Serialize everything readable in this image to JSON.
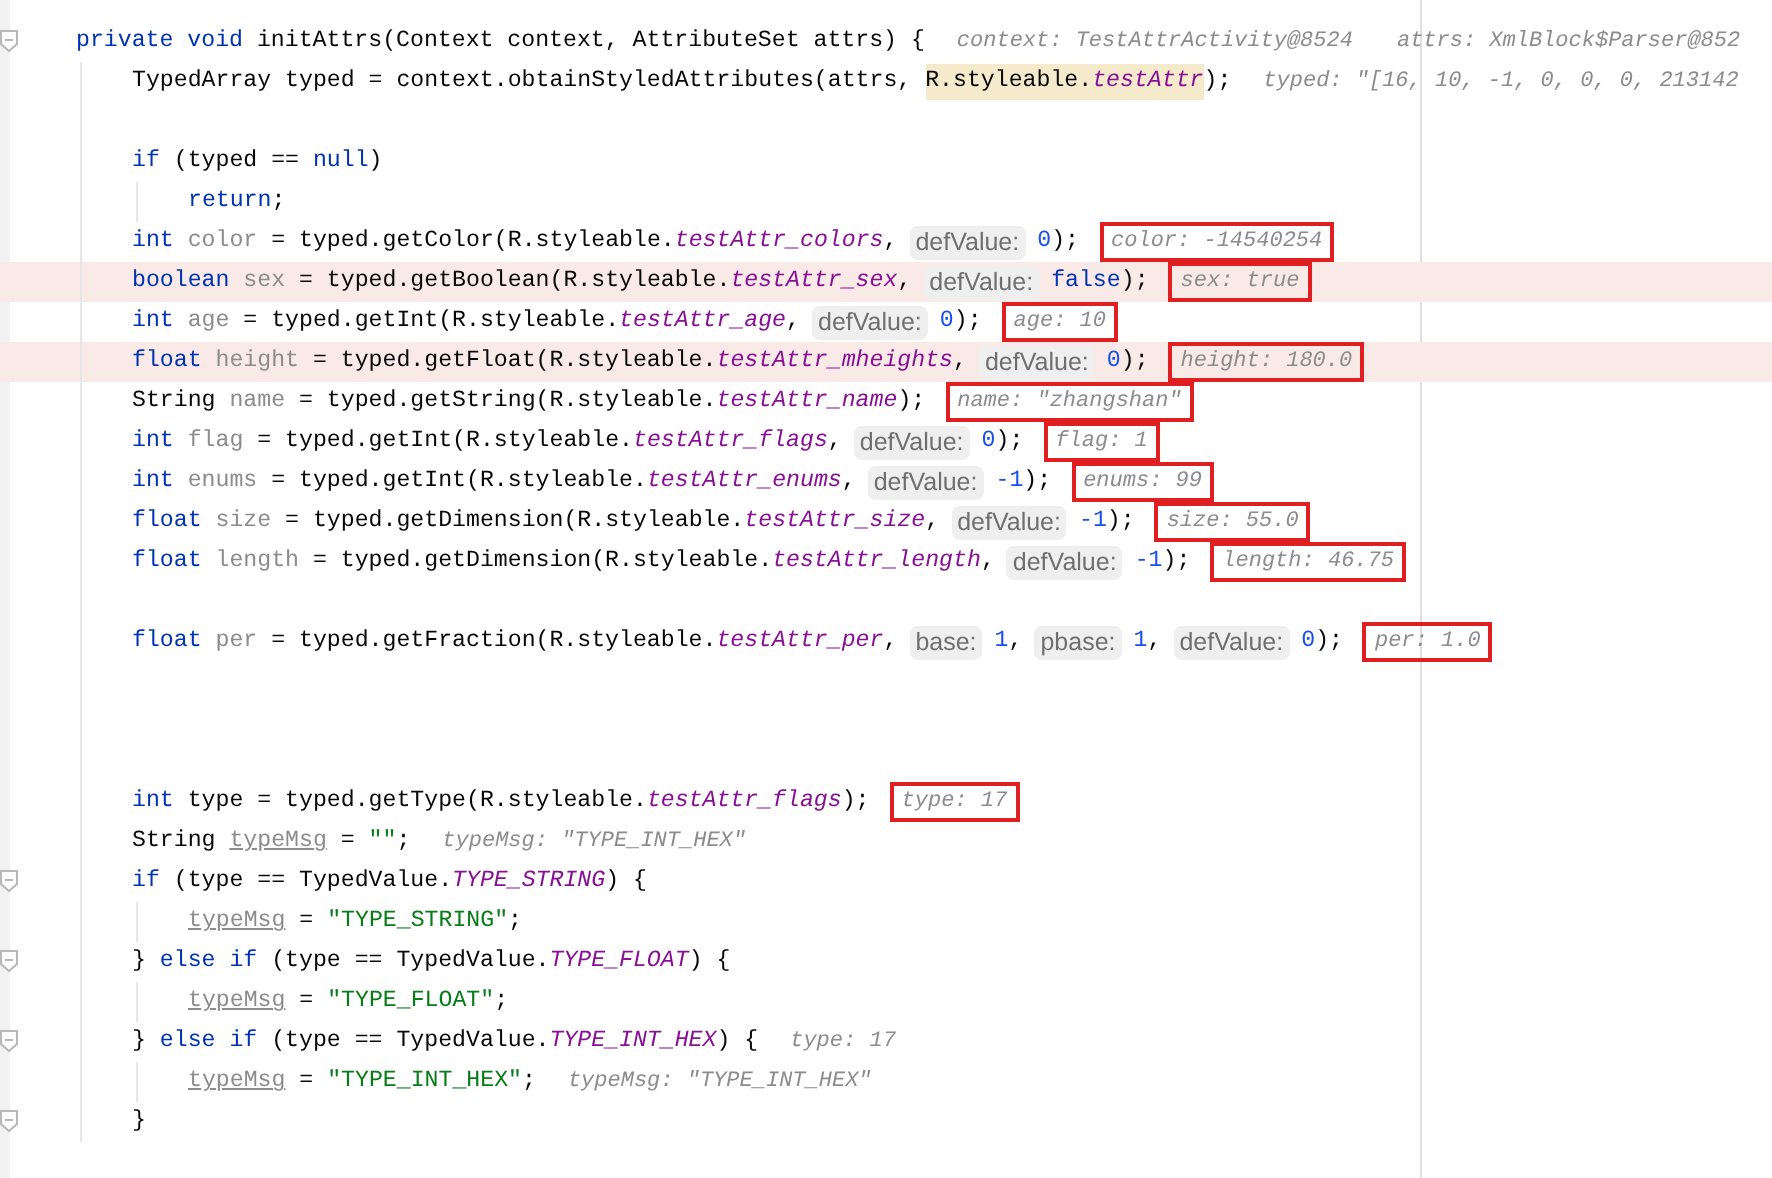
{
  "editor": {
    "lines": [
      {
        "kind": "code",
        "fold_marker": true,
        "tokens": [
          {
            "kind": "kw",
            "text": "private void "
          },
          {
            "kind": "plain",
            "text": "initAttrs(Context context, AttributeSet attrs) {"
          },
          {
            "kind": "inline",
            "text": "context: TestAttrActivity@8524"
          },
          {
            "kind": "inline",
            "text": "attrs: XmlBlock$Parser@852"
          }
        ],
        "children": [
          {
            "kind": "code",
            "tokens": [
              {
                "kind": "plain",
                "text": "TypedArray typed = context.obtainStyledAttributes(attrs, "
              },
              {
                "kind": "plain",
                "text": "R.styleable.",
                "highlighted": true
              },
              {
                "kind": "field",
                "text": "testAttr",
                "highlighted": true
              },
              {
                "kind": "plain",
                "text": ");"
              },
              {
                "kind": "inline",
                "text": "typed: \"[16, 10, -1, 0, 0, 0, 213142"
              }
            ]
          },
          {
            "kind": "blank"
          },
          {
            "kind": "code",
            "tokens": [
              {
                "kind": "kw",
                "text": "if"
              },
              {
                "kind": "plain",
                "text": " (typed == "
              },
              {
                "kind": "kw",
                "text": "null"
              },
              {
                "kind": "plain",
                "text": ")"
              }
            ],
            "children": [
              {
                "kind": "code",
                "tokens": [
                  {
                    "kind": "kw",
                    "text": "return"
                  },
                  {
                    "kind": "plain",
                    "text": ";"
                  }
                ]
              }
            ]
          },
          {
            "kind": "code",
            "tokens": [
              {
                "kind": "kw",
                "text": "int "
              },
              {
                "kind": "unused",
                "text": "color"
              },
              {
                "kind": "plain",
                "text": " = typed.getColor(R.styleable."
              },
              {
                "kind": "field",
                "text": "testAttr_colors"
              },
              {
                "kind": "plain",
                "text": ","
              },
              {
                "kind": "hint",
                "text": "defValue:"
              },
              {
                "kind": "num",
                "text": "0"
              },
              {
                "kind": "plain",
                "text": ");"
              },
              {
                "kind": "inline",
                "text": "color: -14540254",
                "boxed": true
              }
            ]
          },
          {
            "kind": "code",
            "highlighted": true,
            "tokens": [
              {
                "kind": "kw",
                "text": "boolean "
              },
              {
                "kind": "unused",
                "text": "sex"
              },
              {
                "kind": "plain",
                "text": " = typed.getBoolean(R.styleable."
              },
              {
                "kind": "field",
                "text": "testAttr_sex"
              },
              {
                "kind": "plain",
                "text": ","
              },
              {
                "kind": "hint",
                "text": "defValue:"
              },
              {
                "kind": "kw",
                "text": "false"
              },
              {
                "kind": "plain",
                "text": ");"
              },
              {
                "kind": "inline",
                "text": "sex: true",
                "boxed": true
              }
            ]
          },
          {
            "kind": "code",
            "tokens": [
              {
                "kind": "kw",
                "text": "int "
              },
              {
                "kind": "unused",
                "text": "age"
              },
              {
                "kind": "plain",
                "text": " = typed.getInt(R.styleable."
              },
              {
                "kind": "field",
                "text": "testAttr_age"
              },
              {
                "kind": "plain",
                "text": ","
              },
              {
                "kind": "hint",
                "text": "defValue:"
              },
              {
                "kind": "num",
                "text": "0"
              },
              {
                "kind": "plain",
                "text": ");"
              },
              {
                "kind": "inline",
                "text": "age: 10",
                "boxed": true
              }
            ]
          },
          {
            "kind": "code",
            "highlighted": true,
            "tokens": [
              {
                "kind": "kw",
                "text": "float "
              },
              {
                "kind": "unused",
                "text": "height"
              },
              {
                "kind": "plain",
                "text": " = typed.getFloat(R.styleable."
              },
              {
                "kind": "field",
                "text": "testAttr_mheights"
              },
              {
                "kind": "plain",
                "text": ","
              },
              {
                "kind": "hint",
                "text": "defValue:"
              },
              {
                "kind": "num",
                "text": "0"
              },
              {
                "kind": "plain",
                "text": ");"
              },
              {
                "kind": "inline",
                "text": "height: 180.0",
                "boxed": true
              }
            ]
          },
          {
            "kind": "code",
            "tokens": [
              {
                "kind": "plain",
                "text": "String "
              },
              {
                "kind": "unused",
                "text": "name"
              },
              {
                "kind": "plain",
                "text": " = typed.getString(R.styleable."
              },
              {
                "kind": "field",
                "text": "testAttr_name"
              },
              {
                "kind": "plain",
                "text": ");"
              },
              {
                "kind": "inline",
                "text": "name: \"zhangshan\"",
                "boxed": true
              }
            ]
          },
          {
            "kind": "code",
            "tokens": [
              {
                "kind": "kw",
                "text": "int "
              },
              {
                "kind": "unused",
                "text": "flag"
              },
              {
                "kind": "plain",
                "text": " = typed.getInt(R.styleable."
              },
              {
                "kind": "field",
                "text": "testAttr_flags"
              },
              {
                "kind": "plain",
                "text": ","
              },
              {
                "kind": "hint",
                "text": "defValue:"
              },
              {
                "kind": "num",
                "text": "0"
              },
              {
                "kind": "plain",
                "text": ");"
              },
              {
                "kind": "inline",
                "text": "flag: 1",
                "boxed": true
              }
            ]
          },
          {
            "kind": "code",
            "tokens": [
              {
                "kind": "kw",
                "text": "int "
              },
              {
                "kind": "unused",
                "text": "enums"
              },
              {
                "kind": "plain",
                "text": " = typed.getInt(R.styleable."
              },
              {
                "kind": "field",
                "text": "testAttr_enums"
              },
              {
                "kind": "plain",
                "text": ","
              },
              {
                "kind": "hint",
                "text": "defValue:"
              },
              {
                "kind": "num",
                "text": "-1"
              },
              {
                "kind": "plain",
                "text": ");"
              },
              {
                "kind": "inline",
                "text": "enums: 99",
                "boxed": true
              }
            ]
          },
          {
            "kind": "code",
            "tokens": [
              {
                "kind": "kw",
                "text": "float "
              },
              {
                "kind": "unused",
                "text": "size"
              },
              {
                "kind": "plain",
                "text": " = typed.getDimension(R.styleable."
              },
              {
                "kind": "field",
                "text": "testAttr_size"
              },
              {
                "kind": "plain",
                "text": ","
              },
              {
                "kind": "hint",
                "text": "defValue:"
              },
              {
                "kind": "num",
                "text": "-1"
              },
              {
                "kind": "plain",
                "text": ");"
              },
              {
                "kind": "inline",
                "text": "size: 55.0",
                "boxed": true
              }
            ]
          },
          {
            "kind": "code",
            "tokens": [
              {
                "kind": "kw",
                "text": "float "
              },
              {
                "kind": "unused",
                "text": "length"
              },
              {
                "kind": "plain",
                "text": " = typed.getDimension(R.styleable."
              },
              {
                "kind": "field",
                "text": "testAttr_length"
              },
              {
                "kind": "plain",
                "text": ","
              },
              {
                "kind": "hint",
                "text": "defValue:"
              },
              {
                "kind": "num",
                "text": "-1"
              },
              {
                "kind": "plain",
                "text": ");"
              },
              {
                "kind": "inline",
                "text": "length: 46.75",
                "boxed": true
              }
            ]
          },
          {
            "kind": "blank"
          },
          {
            "kind": "code",
            "tokens": [
              {
                "kind": "kw",
                "text": "float "
              },
              {
                "kind": "unused",
                "text": "per"
              },
              {
                "kind": "plain",
                "text": " = typed.getFraction(R.styleable."
              },
              {
                "kind": "field",
                "text": "testAttr_per"
              },
              {
                "kind": "plain",
                "text": ","
              },
              {
                "kind": "hint",
                "text": "base:"
              },
              {
                "kind": "num",
                "text": "1"
              },
              {
                "kind": "plain",
                "text": ","
              },
              {
                "kind": "hint",
                "text": "pbase:"
              },
              {
                "kind": "num",
                "text": "1"
              },
              {
                "kind": "plain",
                "text": ","
              },
              {
                "kind": "hint",
                "text": "defValue:"
              },
              {
                "kind": "num",
                "text": "0"
              },
              {
                "kind": "plain",
                "text": ");"
              },
              {
                "kind": "inline",
                "text": "per: 1.0",
                "boxed": true
              }
            ]
          },
          {
            "kind": "blank"
          },
          {
            "kind": "blank"
          },
          {
            "kind": "blank"
          },
          {
            "kind": "code",
            "tokens": [
              {
                "kind": "kw",
                "text": "int "
              },
              {
                "kind": "plain",
                "text": "type = typed.getType(R.styleable."
              },
              {
                "kind": "field",
                "text": "testAttr_flags"
              },
              {
                "kind": "plain",
                "text": ");"
              },
              {
                "kind": "inline",
                "text": "type: 17",
                "boxed": true
              }
            ]
          },
          {
            "kind": "code",
            "tokens": [
              {
                "kind": "plain",
                "text": "String "
              },
              {
                "kind": "underlined",
                "text": "typeMsg"
              },
              {
                "kind": "plain",
                "text": " = "
              },
              {
                "kind": "str",
                "text": "\"\""
              },
              {
                "kind": "plain",
                "text": ";"
              },
              {
                "kind": "inline",
                "text": "typeMsg: \"TYPE_INT_HEX\""
              }
            ]
          },
          {
            "kind": "code",
            "fold_marker": true,
            "tokens": [
              {
                "kind": "kw",
                "text": "if"
              },
              {
                "kind": "plain",
                "text": " (type == TypedValue."
              },
              {
                "kind": "field",
                "text": "TYPE_STRING"
              },
              {
                "kind": "plain",
                "text": ") {"
              }
            ],
            "children": [
              {
                "kind": "code",
                "tokens": [
                  {
                    "kind": "underlined",
                    "text": "typeMsg"
                  },
                  {
                    "kind": "plain",
                    "text": " = "
                  },
                  {
                    "kind": "str",
                    "text": "\"TYPE_STRING\""
                  },
                  {
                    "kind": "plain",
                    "text": ";"
                  }
                ]
              }
            ]
          },
          {
            "kind": "code",
            "fold_marker": true,
            "tokens": [
              {
                "kind": "plain",
                "text": "} "
              },
              {
                "kind": "kw",
                "text": "else if"
              },
              {
                "kind": "plain",
                "text": " (type == TypedValue."
              },
              {
                "kind": "field",
                "text": "TYPE_FLOAT"
              },
              {
                "kind": "plain",
                "text": ") {"
              }
            ],
            "children": [
              {
                "kind": "code",
                "tokens": [
                  {
                    "kind": "underlined",
                    "text": "typeMsg"
                  },
                  {
                    "kind": "plain",
                    "text": " = "
                  },
                  {
                    "kind": "str",
                    "text": "\"TYPE_FLOAT\""
                  },
                  {
                    "kind": "plain",
                    "text": ";"
                  }
                ]
              }
            ]
          },
          {
            "kind": "code",
            "fold_marker": true,
            "tokens": [
              {
                "kind": "plain",
                "text": "} "
              },
              {
                "kind": "kw",
                "text": "else if"
              },
              {
                "kind": "plain",
                "text": " (type == TypedValue."
              },
              {
                "kind": "field",
                "text": "TYPE_INT_HEX"
              },
              {
                "kind": "plain",
                "text": ") {"
              },
              {
                "kind": "inline",
                "text": "type: 17"
              }
            ],
            "children": [
              {
                "kind": "code",
                "tokens": [
                  {
                    "kind": "underlined",
                    "text": "typeMsg"
                  },
                  {
                    "kind": "plain",
                    "text": " = "
                  },
                  {
                    "kind": "str",
                    "text": "\"TYPE_INT_HEX\""
                  },
                  {
                    "kind": "plain",
                    "text": ";"
                  },
                  {
                    "kind": "inline",
                    "text": "typeMsg: \"TYPE_INT_HEX\""
                  }
                ]
              }
            ]
          },
          {
            "kind": "code",
            "fold_marker": true,
            "tokens": [
              {
                "kind": "plain",
                "text": "}"
              }
            ]
          }
        ]
      }
    ]
  }
}
